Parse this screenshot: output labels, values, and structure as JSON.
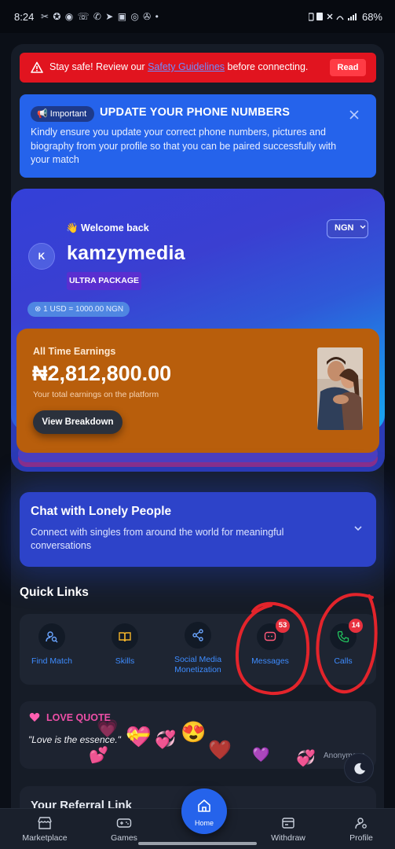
{
  "status_bar": {
    "time": "8:24",
    "left_icons": "✂ ✪ ◉ ☏ ✆ ➤ ▣ ◎ ✇ •",
    "battery": "68%"
  },
  "safety": {
    "text_before": "Stay safe! Review our ",
    "link": "Safety Guidelines",
    "text_after": " before connecting.",
    "button": "Read"
  },
  "important": {
    "badge": "Important",
    "title": "UPDATE YOUR PHONE NUMBERS",
    "body": "Kindly ensure you update your correct phone numbers, pictures and biography from your profile so that you can be paired successfully with your match"
  },
  "welcome": {
    "greeting": "👋 Welcome back",
    "avatar_initial": "K",
    "username": "kamzymedia",
    "package": "ULTRA PACKAGE",
    "currency": "NGN",
    "rate": "⊗ 1 USD = 1000.00 NGN"
  },
  "earnings": {
    "label": "All Time Earnings",
    "value": "₦2,812,800.00",
    "subtitle": "Your total earnings on the platform",
    "button": "View Breakdown"
  },
  "chat": {
    "title": "Chat with Lonely People",
    "body": "Connect with singles from around the world for meaningful conversations"
  },
  "quick_links": {
    "title": "Quick Links",
    "items": [
      {
        "label": "Find Match",
        "icon": "user-search-icon"
      },
      {
        "label": "Skills",
        "icon": "book-icon"
      },
      {
        "label": "Social Media Monetization",
        "icon": "share-icon"
      },
      {
        "label": "Messages",
        "icon": "message-icon",
        "badge": "53"
      },
      {
        "label": "Calls",
        "icon": "phone-icon",
        "badge": "14"
      }
    ]
  },
  "love_quote": {
    "title": "LOVE QUOTE",
    "text": "\"Love is the essence.\"",
    "author": "Anonymous"
  },
  "referral": {
    "title": "Your Referral Link"
  },
  "bottom_nav": {
    "marketplace": "Marketplace",
    "games": "Games",
    "home": "Home",
    "withdraw": "Withdraw",
    "profile": "Profile"
  },
  "colors": {
    "accent": "#2563eb",
    "danger": "#e1141f",
    "earnings": "#b85e0c",
    "quick_link_label": "#3e8cff",
    "love_pink": "#ee4fa7"
  }
}
